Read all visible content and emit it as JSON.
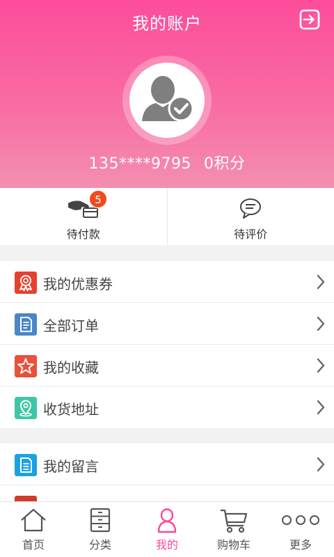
{
  "header": {
    "title": "我的账户",
    "phone": "135****9795",
    "points": "0积分"
  },
  "quick_actions": [
    {
      "label": "待付款",
      "badge": "5",
      "icon": "hand-card-icon"
    },
    {
      "label": "待评价",
      "icon": "chat-bubble-icon"
    }
  ],
  "menu_groups": [
    [
      {
        "label": "我的优惠券",
        "icon": "coupon-icon",
        "color": "#e5412d"
      },
      {
        "label": "全部订单",
        "icon": "order-icon",
        "color": "#4a86c9"
      },
      {
        "label": "我的收藏",
        "icon": "star-icon",
        "color": "#e8513a"
      },
      {
        "label": "收货地址",
        "icon": "location-icon",
        "color": "#3ec6a6"
      }
    ],
    [
      {
        "label": "我的留言",
        "icon": "message-doc-icon",
        "color": "#1ba1e2"
      }
    ]
  ],
  "tabbar": [
    {
      "label": "首页",
      "icon": "home-icon"
    },
    {
      "label": "分类",
      "icon": "category-icon"
    },
    {
      "label": "我的",
      "icon": "user-icon",
      "active": true
    },
    {
      "label": "购物车",
      "icon": "cart-icon"
    },
    {
      "label": "更多",
      "icon": "more-icon"
    }
  ],
  "colors": {
    "brand": "#fd4c9b",
    "badge": "#f24a1b",
    "tab_active": "#f9489a"
  }
}
